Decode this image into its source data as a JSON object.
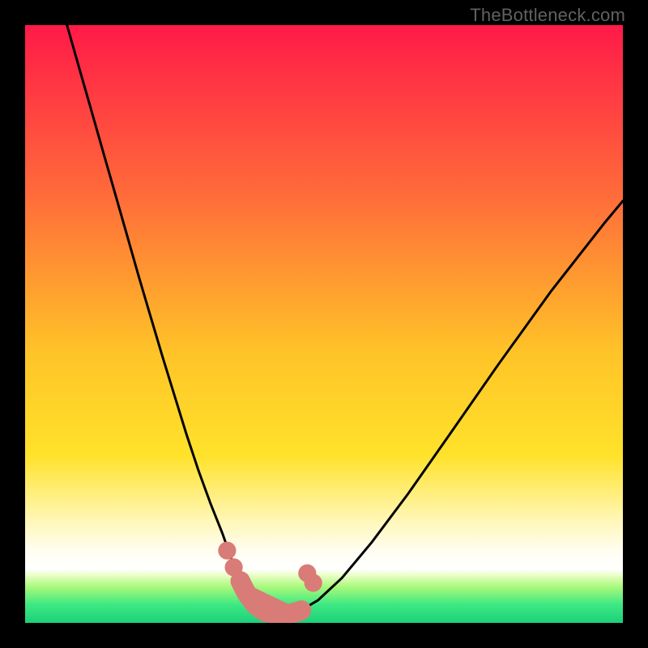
{
  "attribution": "TheBottleneck.com",
  "colors": {
    "topGrad": "#ff1a48",
    "upperMid": "#ff7c33",
    "mid": "#ffe02a",
    "lowerPale": "#fff9c9",
    "greenTop": "#a7f97b",
    "greenMid": "#3de883",
    "greenBase": "#1bd07a",
    "curve": "#000000",
    "marker": "#d97c78",
    "border": "#000000"
  },
  "chart_data": {
    "type": "line",
    "title": "",
    "xlabel": "",
    "ylabel": "",
    "xlim": [
      0,
      1
    ],
    "ylim": [
      0,
      1
    ],
    "grid": false,
    "legend": false,
    "series": [
      {
        "name": "bottleneck-curve",
        "x": [
          0.07,
          0.09,
          0.11,
          0.13,
          0.15,
          0.17,
          0.19,
          0.21,
          0.23,
          0.25,
          0.27,
          0.29,
          0.31,
          0.33,
          0.344,
          0.356,
          0.37,
          0.384,
          0.4,
          0.418,
          0.438,
          0.46,
          0.49,
          0.53,
          0.58,
          0.64,
          0.71,
          0.79,
          0.88,
          0.97,
          1.0
        ],
        "y": [
          1.0,
          0.93,
          0.86,
          0.79,
          0.72,
          0.65,
          0.58,
          0.512,
          0.445,
          0.38,
          0.315,
          0.255,
          0.2,
          0.15,
          0.11,
          0.078,
          0.05,
          0.031,
          0.019,
          0.014,
          0.014,
          0.02,
          0.038,
          0.075,
          0.135,
          0.215,
          0.315,
          0.43,
          0.555,
          0.67,
          0.706
        ]
      }
    ],
    "markers": [
      {
        "name": "left-cluster-top",
        "series": 0,
        "x": 0.338,
        "y": 0.121,
        "r": 0.015
      },
      {
        "name": "left-cluster-bottom",
        "series": 0,
        "x": 0.349,
        "y": 0.093,
        "r": 0.015
      },
      {
        "name": "right-cluster-top",
        "series": 0,
        "x": 0.472,
        "y": 0.083,
        "r": 0.015
      },
      {
        "name": "right-cluster-bottom",
        "series": 0,
        "x": 0.482,
        "y": 0.067,
        "r": 0.015
      }
    ],
    "valley_segment": {
      "name": "valley-highlight",
      "x_start": 0.36,
      "x_end": 0.462,
      "thickness": 0.033
    }
  }
}
